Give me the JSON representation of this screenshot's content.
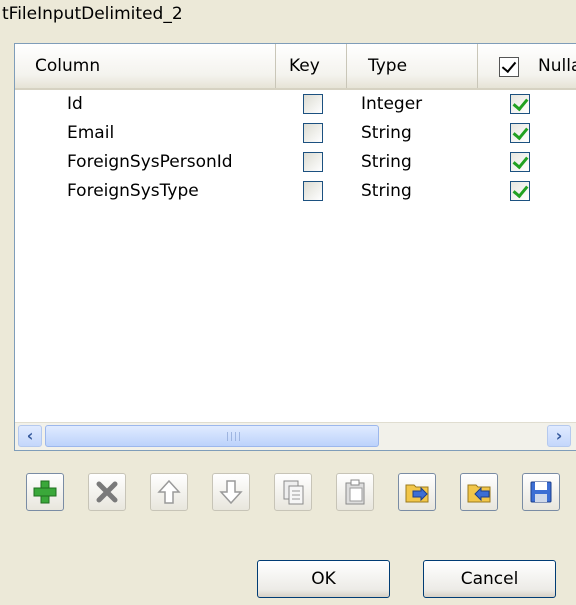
{
  "window": {
    "title": "tFileInputDelimited_2"
  },
  "columns": {
    "column": "Column",
    "key": "Key",
    "type": "Type",
    "nullable": "Nulla"
  },
  "rows": [
    {
      "column": "Id",
      "key": false,
      "type": "Integer",
      "nullable": true
    },
    {
      "column": "Email",
      "key": false,
      "type": "String",
      "nullable": true
    },
    {
      "column": "ForeignSysPersonId",
      "key": false,
      "type": "String",
      "nullable": true
    },
    {
      "column": "ForeignSysType",
      "key": false,
      "type": "String",
      "nullable": true
    }
  ],
  "toolbar": {
    "icons": [
      "add-icon",
      "remove-icon",
      "move-up-icon",
      "move-down-icon",
      "copy-icon",
      "paste-icon",
      "import-icon",
      "export-icon",
      "save-icon"
    ]
  },
  "buttons": {
    "ok": "OK",
    "cancel": "Cancel"
  },
  "colors": {
    "accent": "#21a121",
    "border": "#7f9db9",
    "background": "#ece9d8"
  }
}
